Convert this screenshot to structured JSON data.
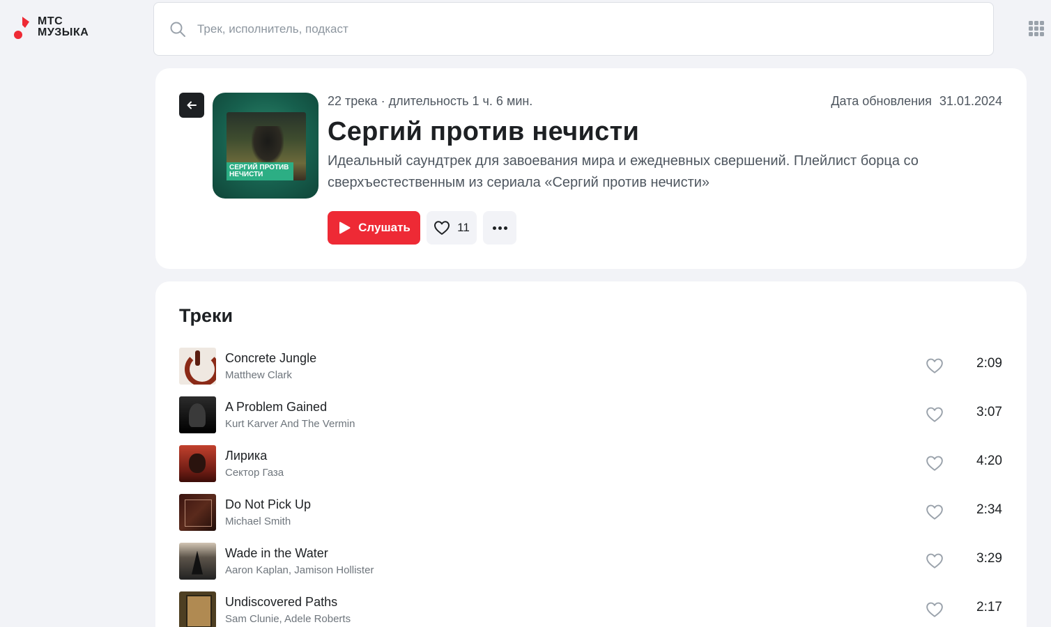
{
  "logo": {
    "line1": "МТС",
    "line2": "МУЗЫКА"
  },
  "search": {
    "placeholder": "Трек, исполнитель, подкаст"
  },
  "playlist": {
    "meta": "22 трека · длительность 1 ч. 6 мин.",
    "updated_label": "Дата обновления",
    "updated_date": "31.01.2024",
    "title": "Сергий против нечисти",
    "description": "Идеальный саундтрек для завоевания мира и ежедневных свершений. Плейлист борца со сверхъестественным из сериала «Сергий против нечисти»",
    "cover_text": "СЕРГИЙ ПРОТИВ НЕЧИСТИ",
    "play_label": "Слушать",
    "likes": "11"
  },
  "tracks_section": {
    "title": "Треки",
    "items": [
      {
        "name": "Concrete Jungle",
        "artist": "Matthew Clark",
        "duration": "2:09"
      },
      {
        "name": "A Problem Gained",
        "artist": "Kurt Karver And The Vermin",
        "duration": "3:07"
      },
      {
        "name": "Лирика",
        "artist": "Сектор Газа",
        "duration": "4:20"
      },
      {
        "name": "Do Not Pick Up",
        "artist": "Michael Smith",
        "duration": "2:34"
      },
      {
        "name": "Wade in the Water",
        "artist": "Aaron Kaplan, Jamison Hollister",
        "duration": "3:29"
      },
      {
        "name": "Undiscovered Paths",
        "artist": "Sam Clunie, Adele Roberts",
        "duration": "2:17"
      }
    ]
  },
  "colors": {
    "accent": "#ee2a35",
    "background": "#f2f3f7",
    "cover_green": "#17604e"
  },
  "icons": [
    "logo-icon",
    "search-icon",
    "apps-grid-icon",
    "arrow-left-icon",
    "play-icon",
    "heart-icon",
    "more-icon"
  ]
}
